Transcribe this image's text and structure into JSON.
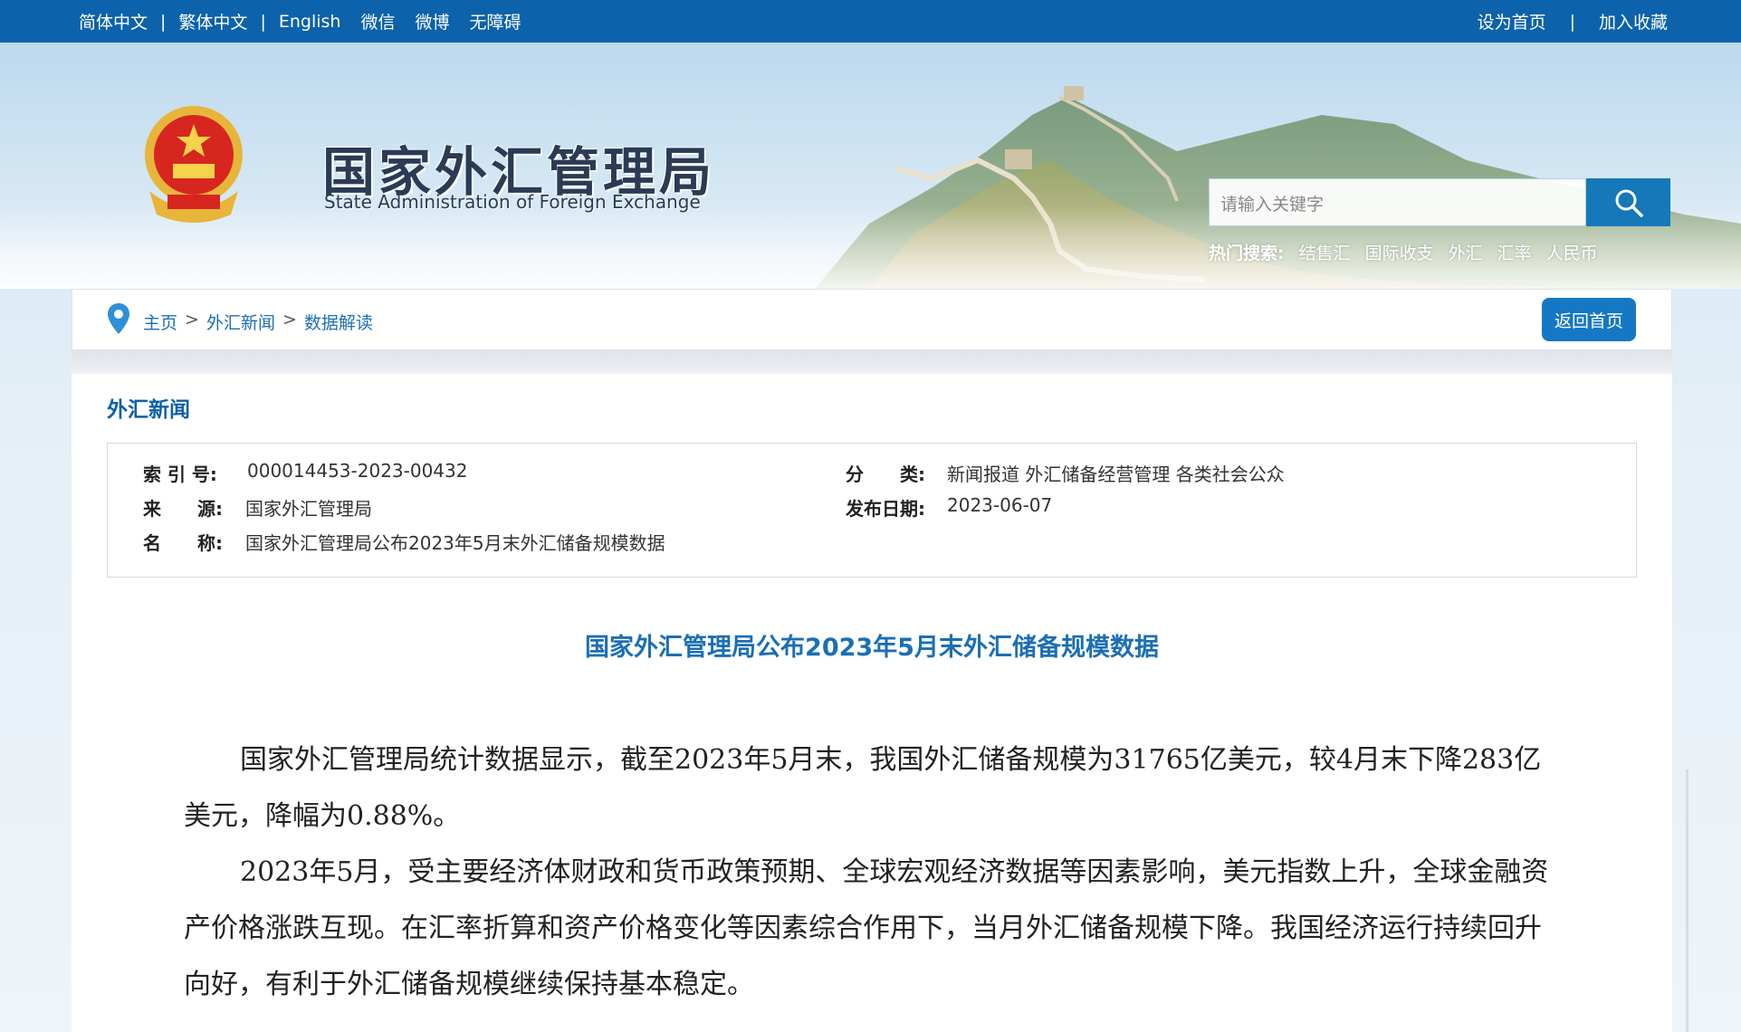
{
  "topbar": {
    "left": [
      "简体中文",
      "繁体中文",
      "English",
      "微信",
      "微博",
      "无障碍"
    ],
    "right": [
      "设为首页",
      "加入收藏"
    ],
    "separator": "|"
  },
  "header": {
    "title": "国家外汇管理局",
    "subtitle": "State Administration of Foreign Exchange",
    "search_placeholder": "请输入关键字",
    "hot_label": "热门搜索:",
    "hot_terms": [
      "结售汇",
      "国际收支",
      "外汇",
      "汇率",
      "人民币"
    ]
  },
  "breadcrumb": {
    "items": [
      "主页",
      "外汇新闻",
      "数据解读"
    ],
    "arrow": ">",
    "back_label": "返回首页"
  },
  "section": {
    "title": "外汇新闻"
  },
  "meta": {
    "index_label": "索 引 号:",
    "index_value": "000014453-2023-00432",
    "category_label": "分　　类:",
    "category_value": "新闻报道  外汇储备经营管理  各类社会公众",
    "source_label": "来　　源:",
    "source_value": "国家外汇管理局",
    "date_label": "发布日期:",
    "date_value": "2023-06-07",
    "name_label": "名　　称:",
    "name_value": "国家外汇管理局公布2023年5月末外汇储备规模数据"
  },
  "article": {
    "title": "国家外汇管理局公布2023年5月末外汇储备规模数据",
    "paragraphs": [
      "国家外汇管理局统计数据显示，截至2023年5月末，我国外汇储备规模为31765亿美元，较4月末下降283亿美元，降幅为0.88%。",
      "2023年5月，受主要经济体财政和货币政策预期、全球宏观经济数据等因素影响，美元指数上升，全球金融资产价格涨跌互现。在汇率折算和资产价格变化等因素综合作用下，当月外汇储备规模下降。我国经济运行持续回升向好，有利于外汇储备规模继续保持基本稳定。"
    ]
  },
  "colors": {
    "topbar": "#0c62ab",
    "link": "#1b6fb4",
    "button": "#1578c4"
  }
}
